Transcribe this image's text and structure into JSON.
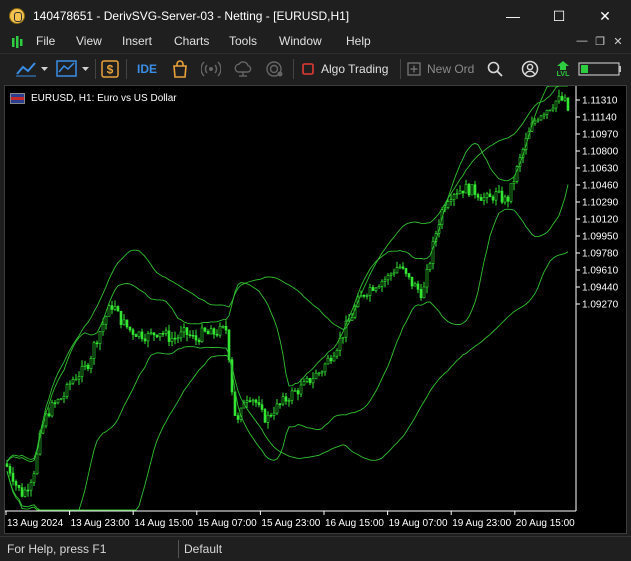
{
  "window": {
    "title": "140478651 - DerivSVG-Server-03 - Netting - [EURUSD,H1]",
    "minimize": "—",
    "maximize": "☐",
    "close": "✕"
  },
  "menu": {
    "items": [
      "File",
      "View",
      "Insert",
      "Charts",
      "Tools",
      "Window",
      "Help"
    ],
    "mdi_minimize": "—",
    "mdi_restore": "❐",
    "mdi_close": "✕"
  },
  "toolbar": {
    "ide_label": "IDE",
    "algo_trading_label": "Algo Trading",
    "new_order_label": "New Ord",
    "level_badge": "LVL",
    "icons": [
      "chart-type-icon",
      "indicators-icon",
      "dollar-icon",
      "ide-icon",
      "market-icon",
      "signals-icon",
      "vps-icon",
      "services-icon",
      "algo-trading-icon",
      "new-order-icon",
      "search-icon",
      "account-icon",
      "level-icon",
      "battery-icon"
    ],
    "colors": {
      "accent": "#3a8ee6",
      "market": "#e9a23b",
      "algo_off": "#e53935",
      "level": "#2ecc40"
    }
  },
  "chart": {
    "symbol_label": "EURUSD, H1:  Euro vs US Dollar",
    "colors": {
      "background": "#000000",
      "candles": "#33e633",
      "bands": "#30c030",
      "text": "#ffffff"
    }
  },
  "chart_data": {
    "type": "candlestick",
    "symbol": "EURUSD",
    "timeframe": "H1",
    "y_ticks": [
      "1.11310",
      "1.11140",
      "1.10970",
      "1.10800",
      "1.10630",
      "1.10460",
      "1.10290",
      "1.10120",
      "1.09950",
      "1.09780",
      "1.09610",
      "1.09440",
      "1.09270"
    ],
    "x_ticks": [
      "13 Aug 2024",
      "13 Aug 23:00",
      "14 Aug 15:00",
      "15 Aug 07:00",
      "15 Aug 23:00",
      "16 Aug 15:00",
      "19 Aug 07:00",
      "19 Aug 23:00",
      "20 Aug 15:00"
    ],
    "ylim": [
      1.0918,
      1.1138
    ],
    "indicator": "Bollinger Bands (two bands)",
    "close_path": [
      [
        0,
        1.0942
      ],
      [
        6,
        1.0938
      ],
      [
        12,
        1.093
      ],
      [
        18,
        1.0926
      ],
      [
        24,
        1.0932
      ],
      [
        30,
        1.094
      ],
      [
        36,
        1.0958
      ],
      [
        42,
        1.0968
      ],
      [
        48,
        1.0972
      ],
      [
        54,
        1.0975
      ],
      [
        60,
        1.0978
      ],
      [
        66,
        1.0985
      ],
      [
        72,
        1.0988
      ],
      [
        78,
        1.099
      ],
      [
        84,
        1.0995
      ],
      [
        90,
        1.1005
      ],
      [
        96,
        1.1012
      ],
      [
        102,
        1.102
      ],
      [
        108,
        1.1025
      ],
      [
        114,
        1.1018
      ],
      [
        120,
        1.1014
      ],
      [
        126,
        1.1011
      ],
      [
        132,
        1.101
      ],
      [
        138,
        1.1009
      ],
      [
        144,
        1.1008
      ],
      [
        150,
        1.101
      ],
      [
        156,
        1.1011
      ],
      [
        162,
        1.1008
      ],
      [
        168,
        1.1007
      ],
      [
        174,
        1.1008
      ],
      [
        180,
        1.101
      ],
      [
        186,
        1.1008
      ],
      [
        190,
        1.1006
      ],
      [
        194,
        1.1008
      ],
      [
        198,
        1.101
      ],
      [
        204,
        1.1009
      ],
      [
        210,
        1.101
      ],
      [
        216,
        1.1011
      ],
      [
        222,
        1.1012
      ],
      [
        226,
        1.0985
      ],
      [
        230,
        1.0968
      ],
      [
        234,
        1.0962
      ],
      [
        238,
        1.0975
      ],
      [
        244,
        1.0978
      ],
      [
        250,
        1.0975
      ],
      [
        256,
        1.0968
      ],
      [
        262,
        1.0965
      ],
      [
        268,
        1.097
      ],
      [
        274,
        1.0972
      ],
      [
        280,
        1.0975
      ],
      [
        286,
        1.0978
      ],
      [
        292,
        1.098
      ],
      [
        298,
        1.0982
      ],
      [
        304,
        1.0985
      ],
      [
        310,
        1.0988
      ],
      [
        316,
        1.099
      ],
      [
        322,
        1.0995
      ],
      [
        328,
        1.1
      ],
      [
        334,
        1.1005
      ],
      [
        340,
        1.1012
      ],
      [
        346,
        1.1018
      ],
      [
        352,
        1.1025
      ],
      [
        358,
        1.103
      ],
      [
        364,
        1.1033
      ],
      [
        370,
        1.1035
      ],
      [
        376,
        1.1037
      ],
      [
        382,
        1.1038
      ],
      [
        388,
        1.1042
      ],
      [
        394,
        1.1045
      ],
      [
        400,
        1.104
      ],
      [
        406,
        1.1036
      ],
      [
        412,
        1.1033
      ],
      [
        418,
        1.103
      ],
      [
        424,
        1.1045
      ],
      [
        430,
        1.106
      ],
      [
        436,
        1.1072
      ],
      [
        442,
        1.108
      ],
      [
        448,
        1.1083
      ],
      [
        454,
        1.1084
      ],
      [
        460,
        1.1085
      ],
      [
        466,
        1.1084
      ],
      [
        472,
        1.1083
      ],
      [
        478,
        1.108
      ],
      [
        484,
        1.1079
      ],
      [
        490,
        1.1082
      ],
      [
        496,
        1.108
      ],
      [
        502,
        1.1078
      ],
      [
        508,
        1.1088
      ],
      [
        514,
        1.1098
      ],
      [
        520,
        1.1108
      ],
      [
        526,
        1.1116
      ],
      [
        532,
        1.1122
      ],
      [
        538,
        1.1125
      ],
      [
        544,
        1.1127
      ],
      [
        550,
        1.113
      ],
      [
        556,
        1.1131
      ],
      [
        561,
        1.1129
      ],
      [
        565,
        1.1122
      ]
    ]
  },
  "status": {
    "help_text": "For Help, press F1",
    "profile": "Default"
  }
}
